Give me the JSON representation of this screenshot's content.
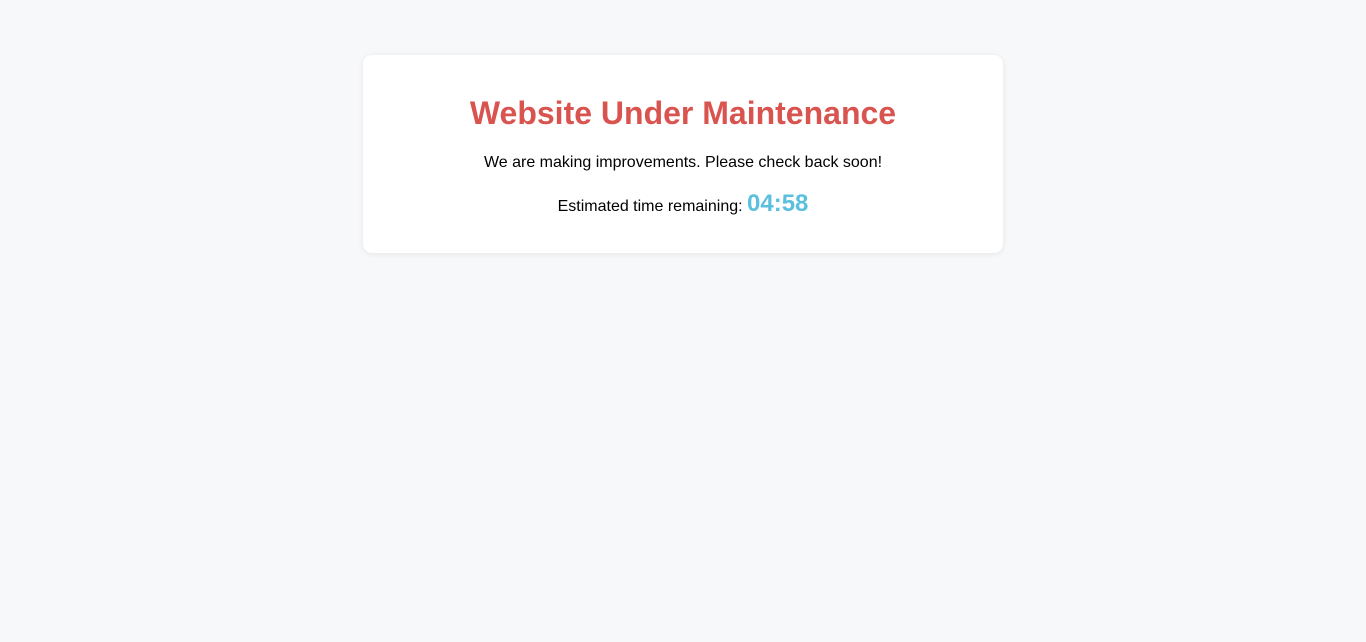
{
  "maintenance": {
    "title": "Website Under Maintenance",
    "message": "We are making improvements. Please check back soon!",
    "countdown_label": "Estimated time remaining:",
    "countdown_value": "04:58"
  },
  "colors": {
    "title": "#d9534f",
    "timer": "#5bc0de",
    "background": "#f7f8fa",
    "card": "#ffffff"
  }
}
